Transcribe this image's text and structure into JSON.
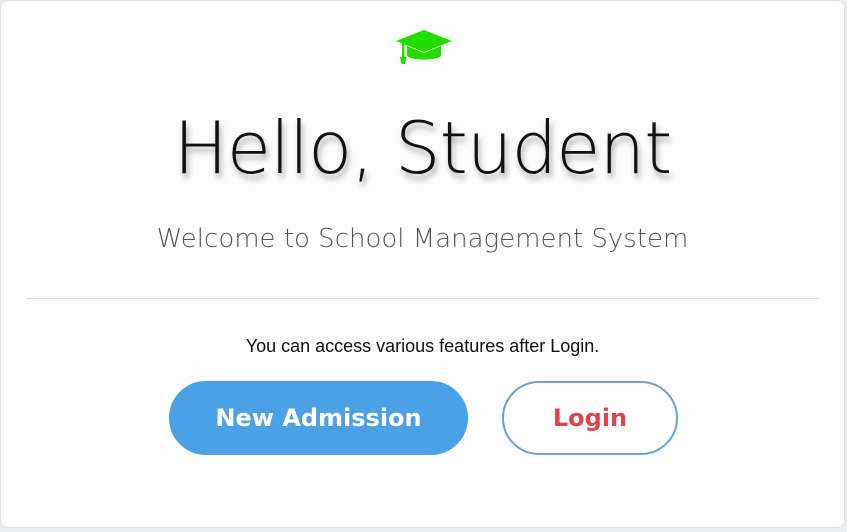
{
  "logo": {
    "icon": "graduation-cap-icon",
    "color": "#22dd00"
  },
  "hero": {
    "title": "Hello, Student",
    "subtitle": "Welcome to School Management System"
  },
  "info": {
    "text": "You can access various features after Login."
  },
  "actions": {
    "new_admission_label": "New Admission",
    "login_label": "Login"
  },
  "colors": {
    "primary": "#4aa1e6",
    "login_text": "#e34248",
    "login_border": "#6aa3cf"
  }
}
